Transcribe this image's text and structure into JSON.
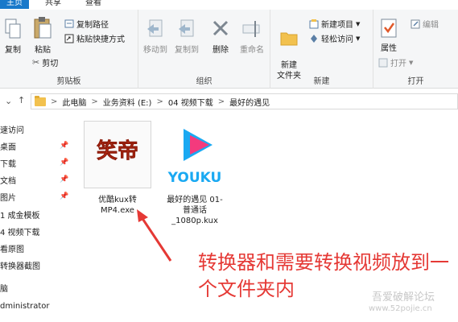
{
  "tabs": [
    "主页",
    "共享",
    "查看"
  ],
  "clipboard": {
    "group_label": "剪贴板",
    "copy": "复制",
    "paste": "粘贴",
    "copy_path": "复制路径",
    "paste_shortcut": "粘贴快捷方式",
    "cut": "剪切"
  },
  "organize": {
    "group_label": "组织",
    "move_to": "移动到",
    "copy_to": "复制到",
    "delete": "删除",
    "rename": "重命名"
  },
  "new_group": {
    "group_label": "新建",
    "new_folder": "新建\n文件夹",
    "new_item": "新建项目",
    "easy_access": "轻松访问"
  },
  "open_group": {
    "group_label": "打开",
    "properties": "属性",
    "edit": "编辑",
    "open": "打开"
  },
  "address": {
    "crumbs": [
      "此电脑",
      "业务资料 (E:)",
      "04 视频下载",
      "最好的遇见"
    ],
    "separator": ">"
  },
  "nav_pane": [
    "速访问",
    "桌面",
    "下载",
    "文档",
    "图片",
    "1 成金模板",
    "4 视频下载",
    "看原图",
    "转换器截图",
    "脑",
    "dministrator"
  ],
  "files": [
    {
      "name": "优酷kux转\nMP4.exe",
      "icon": "kux-converter-icon",
      "icon_text": "笑帝"
    },
    {
      "name": "最好的遇见 01-\n普通话\n_1080p.kux",
      "icon": "youku-icon",
      "icon_text": "YOUKU"
    }
  ],
  "annotation": "转换器和需要转换视频放到一个文件夹内",
  "watermark": {
    "line1": "吾爱破解论坛",
    "line2": "www.52pojie.cn"
  },
  "colors": {
    "accent": "#1979ca",
    "annotation": "#e53935",
    "youku_blue": "#1aa9f2",
    "youku_pink": "#f43a7d"
  }
}
